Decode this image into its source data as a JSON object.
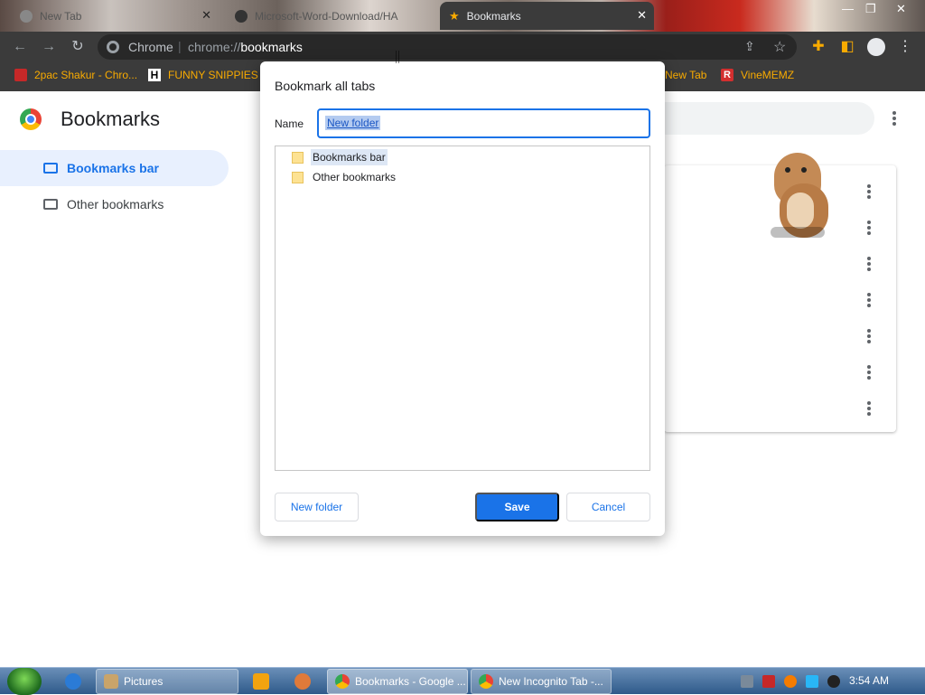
{
  "tabs": [
    {
      "title": "New Tab"
    },
    {
      "title": "Microsoft-Word-Download/HA"
    },
    {
      "title": "Bookmarks"
    }
  ],
  "omnibox": {
    "scheme_label": "Chrome",
    "url_prefix": "chrome://",
    "url_host": "bookmarks"
  },
  "bookmarks_bar": {
    "items": [
      {
        "label": "2pac Shakur - Chro..."
      },
      {
        "label": "FUNNY SNIPPIES"
      },
      {
        "label": "New Tab"
      },
      {
        "label": "VineMEMZ"
      }
    ]
  },
  "page": {
    "title": "Bookmarks",
    "sidebar": [
      {
        "label": "Bookmarks bar",
        "selected": true
      },
      {
        "label": "Other bookmarks",
        "selected": false
      }
    ]
  },
  "dialog": {
    "title": "Bookmark all tabs",
    "name_label": "Name",
    "name_value": "New folder",
    "tree": [
      {
        "label": "Bookmarks bar",
        "selected": true
      },
      {
        "label": "Other bookmarks",
        "selected": false
      }
    ],
    "new_folder_label": "New folder",
    "save_label": "Save",
    "cancel_label": "Cancel"
  },
  "taskbar": {
    "tasks": [
      {
        "label": "Pictures"
      },
      {
        "label": "Bookmarks - Google ..."
      },
      {
        "label": "New Incognito Tab -..."
      }
    ],
    "clock": "3:54 AM"
  },
  "colors": {
    "accent": "#1a73e8",
    "toolbar": "#3b3b3b",
    "bookmark_text": "#f9ab00"
  }
}
